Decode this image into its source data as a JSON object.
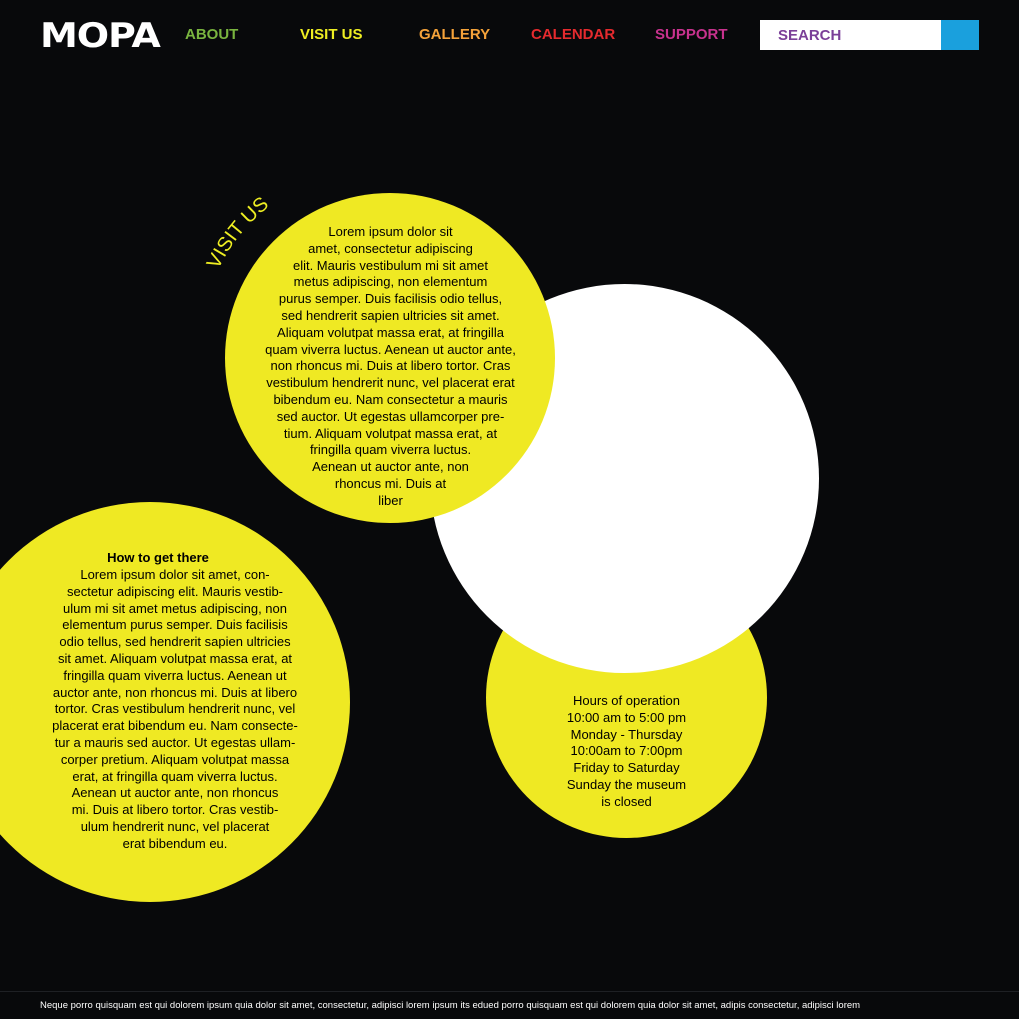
{
  "header": {
    "logo": "MOPA",
    "nav": [
      {
        "label": "ABOUT",
        "color": "#79b43f"
      },
      {
        "label": "VISIT US",
        "color": "#eeee22"
      },
      {
        "label": "GALLERY",
        "color": "#f4a23a"
      },
      {
        "label": "CALENDAR",
        "color": "#e52a2e"
      },
      {
        "label": "SUPPORT",
        "color": "#c8328e"
      }
    ],
    "search": {
      "placeholder": "SEARCH",
      "button_icon": "search-icon",
      "button_color": "#1aa0dd"
    }
  },
  "main": {
    "section_label": "VISIT US",
    "intro_text": "Lorem ipsum dolor sit\namet, consectetur adipiscing\nelit. Mauris vestibulum mi sit amet\nmetus adipiscing, non elementum\npurus semper. Duis facilisis odio tellus,\nsed hendrerit sapien ultricies sit amet.\nAliquam volutpat massa erat, at fringilla\nquam viverra luctus. Aenean ut auctor ante,\nnon rhoncus mi. Duis at libero tortor. Cras\nvestibulum hendrerit nunc, vel placerat erat\nbibendum eu. Nam consectetur a mauris\nsed auctor. Ut egestas ullamcorper pre-\ntium. Aliquam volutpat massa erat, at\nfringilla quam viverra luctus.\nAenean ut auctor ante, non\nrhoncus mi. Duis at\nliber",
    "directions": {
      "title": "How to get there",
      "text": "Lorem ipsum dolor sit amet, con-\nsectetur adipiscing elit. Mauris vestib-\nulum mi sit amet metus adipiscing, non\nelementum purus semper. Duis facilisis\nodio tellus, sed hendrerit sapien ultricies\nsit amet. Aliquam volutpat massa erat, at\nfringilla quam viverra luctus. Aenean ut\nauctor ante, non rhoncus mi. Duis at libero\ntortor. Cras vestibulum hendrerit nunc, vel\nplacerat erat bibendum eu. Nam consecte-\ntur a mauris sed auctor. Ut egestas ullam-\ncorper pretium. Aliquam volutpat massa\nerat, at fringilla quam viverra luctus.\nAenean ut auctor ante, non rhoncus\nmi. Duis at libero tortor. Cras vestib-\nulum hendrerit nunc, vel placerat\nerat bibendum eu."
    },
    "hours": {
      "text": "Hours of operation\n10:00 am to 5:00 pm\nMonday - Thursday\n10:00am to 7:00pm\nFriday to Saturday\nSunday the museum\nis closed"
    },
    "colors": {
      "circle_yellow": "#efe923",
      "circle_white": "#ffffff",
      "background": "#08090b"
    }
  },
  "footer": {
    "text": "Neque porro quisquam est qui dolorem ipsum quia dolor sit amet, consectetur, adipisci lorem ipsum its edued porro quisquam est qui dolorem quia dolor sit amet, adipis  consectetur, adipisci lorem"
  }
}
